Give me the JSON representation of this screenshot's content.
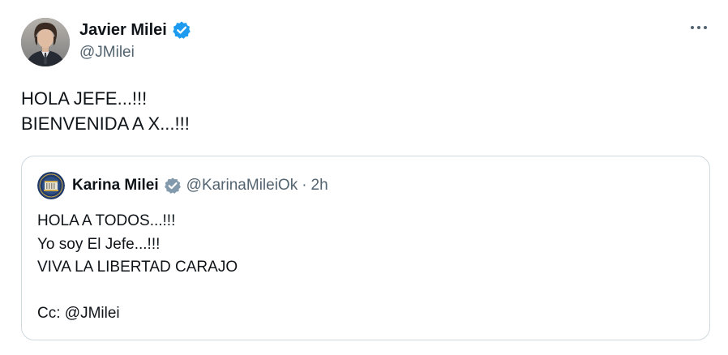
{
  "tweet": {
    "author_name": "Javier Milei",
    "author_handle": "@JMilei",
    "verified": true,
    "more_icon": "more-horizontal-icon",
    "text_lines": [
      "HOLA JEFE...!!!",
      "BIENVENIDA A X...!!!"
    ]
  },
  "quoted": {
    "author_name": "Karina Milei",
    "author_handle": "@KarinaMileiOk",
    "separator": "·",
    "time": "2h",
    "verified_color": "gray",
    "text_lines": [
      "HOLA A TODOS...!!!",
      "Yo soy El Jefe...!!!",
      "VIVA LA LIBERTAD CARAJO",
      "",
      "Cc: @JMilei"
    ]
  },
  "colors": {
    "verified_blue": "#1d9bf0",
    "verified_gray": "#829aab",
    "secondary_text": "#536471",
    "border": "#cfd9de"
  }
}
